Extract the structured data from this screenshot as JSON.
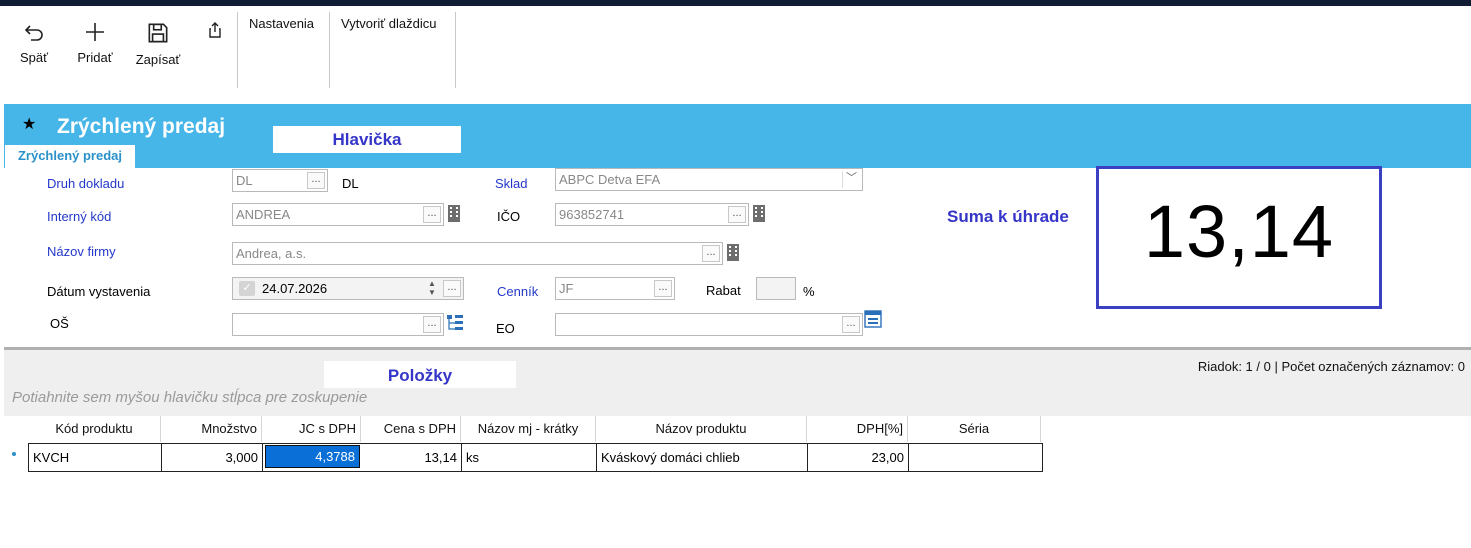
{
  "toolbar": {
    "back_label": "Späť",
    "add_label": "Pridať",
    "save_label": "Zapísať",
    "settings_label": "Nastavenia",
    "create_tile_label": "Vytvoriť dlaždicu"
  },
  "header": {
    "title": "Zrýchlený predaj",
    "tab_label": "Zrýchlený predaj",
    "section_label": "Hlavička"
  },
  "form": {
    "doc_type_label": "Druh dokladu",
    "doc_type_value": "DL",
    "doc_type_text": "DL",
    "warehouse_label": "Sklad",
    "warehouse_value": "ABPC Detva EFA",
    "internal_code_label": "Interný kód",
    "internal_code_value": "ANDREA",
    "ico_label": "IČO",
    "ico_value": "963852741",
    "company_label": "Názov firmy",
    "company_value": "Andrea, a.s.",
    "issue_date_label": "Dátum vystavenia",
    "issue_date_value": "24.07.2026",
    "pricelist_label": "Cenník",
    "pricelist_value": "JF",
    "discount_label": "Rabat",
    "discount_value": "",
    "percent_sign": "%",
    "os_label": "OŠ",
    "os_value": "",
    "eo_label": "EO",
    "eo_value": "",
    "dots": "..."
  },
  "summary": {
    "label": "Suma k úhrade",
    "value": "13,14"
  },
  "grid": {
    "section_label": "Položky",
    "status": "Riadok: 1 / 0 | Počet označených záznamov: 0",
    "group_hint": "Potiahnite sem myšou hlavičku stĺpca pre zoskupenie",
    "columns": [
      "Kód produktu",
      "Množstvo",
      "JC s DPH",
      "Cena s DPH",
      "Názov mj - krátky",
      "Názov produktu",
      "DPH[%]",
      "Séria"
    ],
    "rows": [
      [
        "KVCH",
        "3,000",
        "4,3788",
        "13,14",
        "ks",
        "Kváskový domáci chlieb",
        "23,00",
        ""
      ]
    ]
  },
  "icons": {
    "back": "undo-arrow-icon",
    "add": "plus-icon",
    "save": "floppy-disk-icon",
    "share": "share-icon",
    "star": "star-icon",
    "building": "building-icon",
    "tree": "tree-list-icon"
  },
  "colors": {
    "banner": "#46b6e9",
    "label_blue": "#2338c9",
    "accent_purple": "#3535c8",
    "selection": "#0a70d8"
  }
}
